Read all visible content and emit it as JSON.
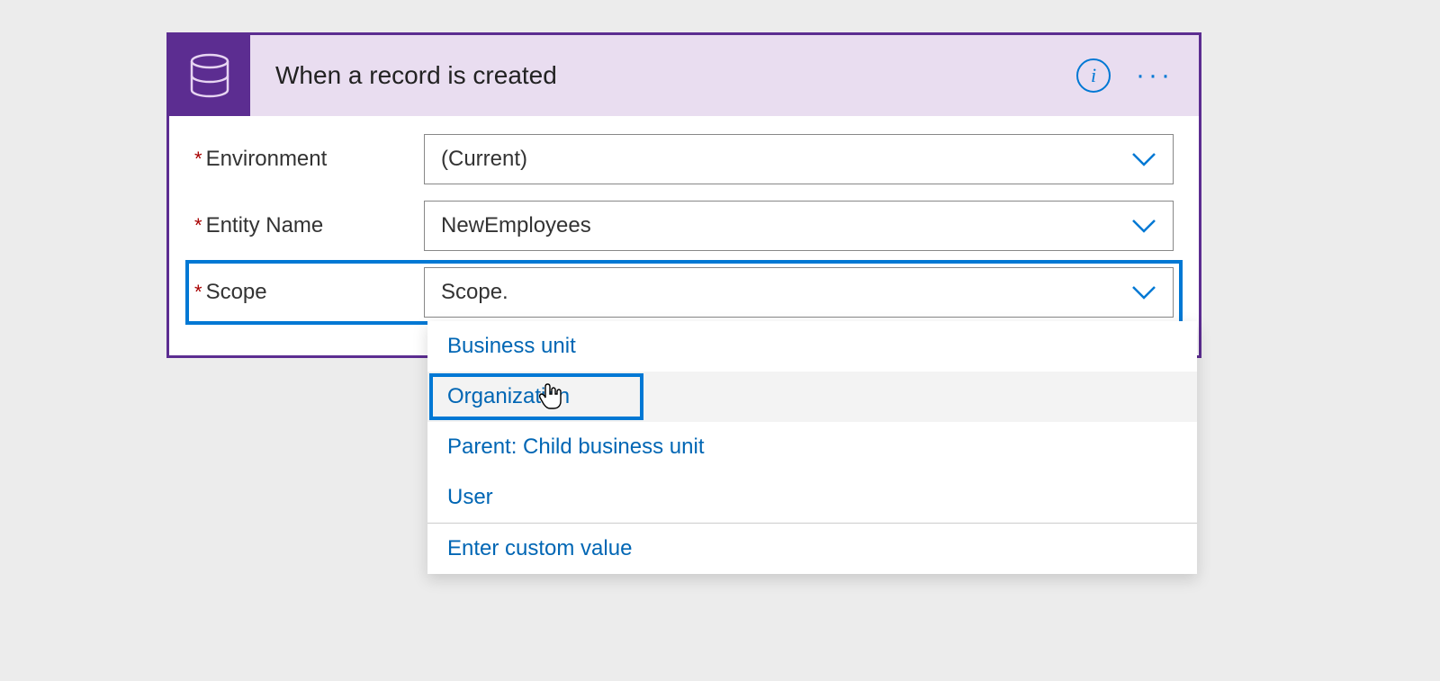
{
  "card": {
    "title": "When a record is created"
  },
  "fields": {
    "environment": {
      "label": "Environment",
      "value": "(Current)"
    },
    "entity": {
      "label": "Entity Name",
      "value": "NewEmployees"
    },
    "scope": {
      "label": "Scope",
      "value": "Scope."
    }
  },
  "dropdown": {
    "options": [
      "Business unit",
      "Organization",
      "Parent: Child business unit",
      "User"
    ],
    "custom": "Enter custom value"
  }
}
